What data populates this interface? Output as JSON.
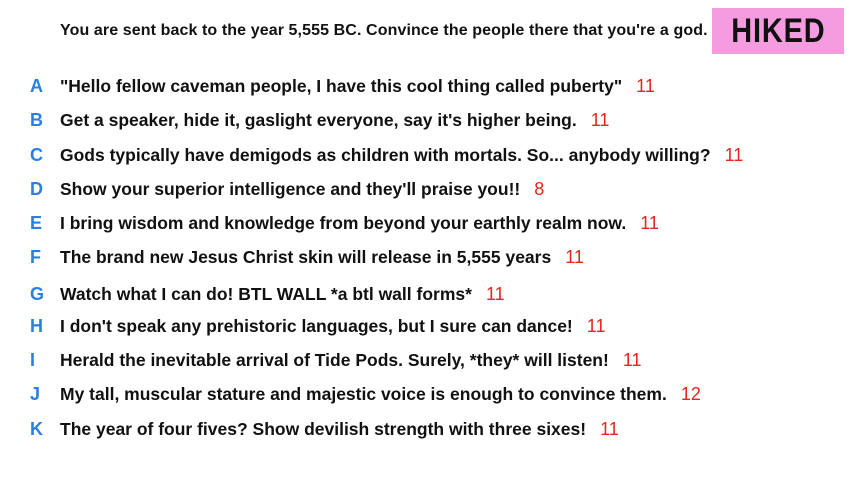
{
  "prompt": "You are sent back to the year 5,555 BC. Convince the people there that you're a god.",
  "badge": "HIKED",
  "colors": {
    "letter": "#2a7fe0",
    "score": "#e5261f",
    "badge_bg": "#f59ce0"
  },
  "answers": [
    {
      "letter": "A",
      "text": "\"Hello fellow caveman people, I have this cool thing called puberty\"",
      "score": "11"
    },
    {
      "letter": "B",
      "text": "Get a speaker, hide it, gaslight everyone, say it's higher being.",
      "score": "11"
    },
    {
      "letter": "C",
      "text": "Gods typically have demigods as children with mortals. So... anybody willing?",
      "score": "11"
    },
    {
      "letter": "D",
      "text": "Show your superior intelligence and they'll praise you!!",
      "score": "8"
    },
    {
      "letter": "E",
      "text": "I bring wisdom and knowledge from beyond your earthly realm now.",
      "score": "11"
    },
    {
      "letter": "F",
      "text": "The brand new Jesus Christ skin will release in 5,555 years",
      "score": "11"
    },
    {
      "letter": "G",
      "text": "Watch what I can do! BTL WALL *a btl wall forms*",
      "score": "11"
    },
    {
      "letter": "H",
      "text": "I don't speak any prehistoric languages, but I sure can dance!",
      "score": "11"
    },
    {
      "letter": "I",
      "text": "Herald the inevitable arrival of Tide Pods. Surely, *they* will listen!",
      "score": "11"
    },
    {
      "letter": "J",
      "text": "My tall, muscular stature and majestic voice is enough to convince them.",
      "score": "12"
    },
    {
      "letter": "K",
      "text": "The year of four fives? Show devilish strength with three sixes!",
      "score": "11"
    }
  ]
}
